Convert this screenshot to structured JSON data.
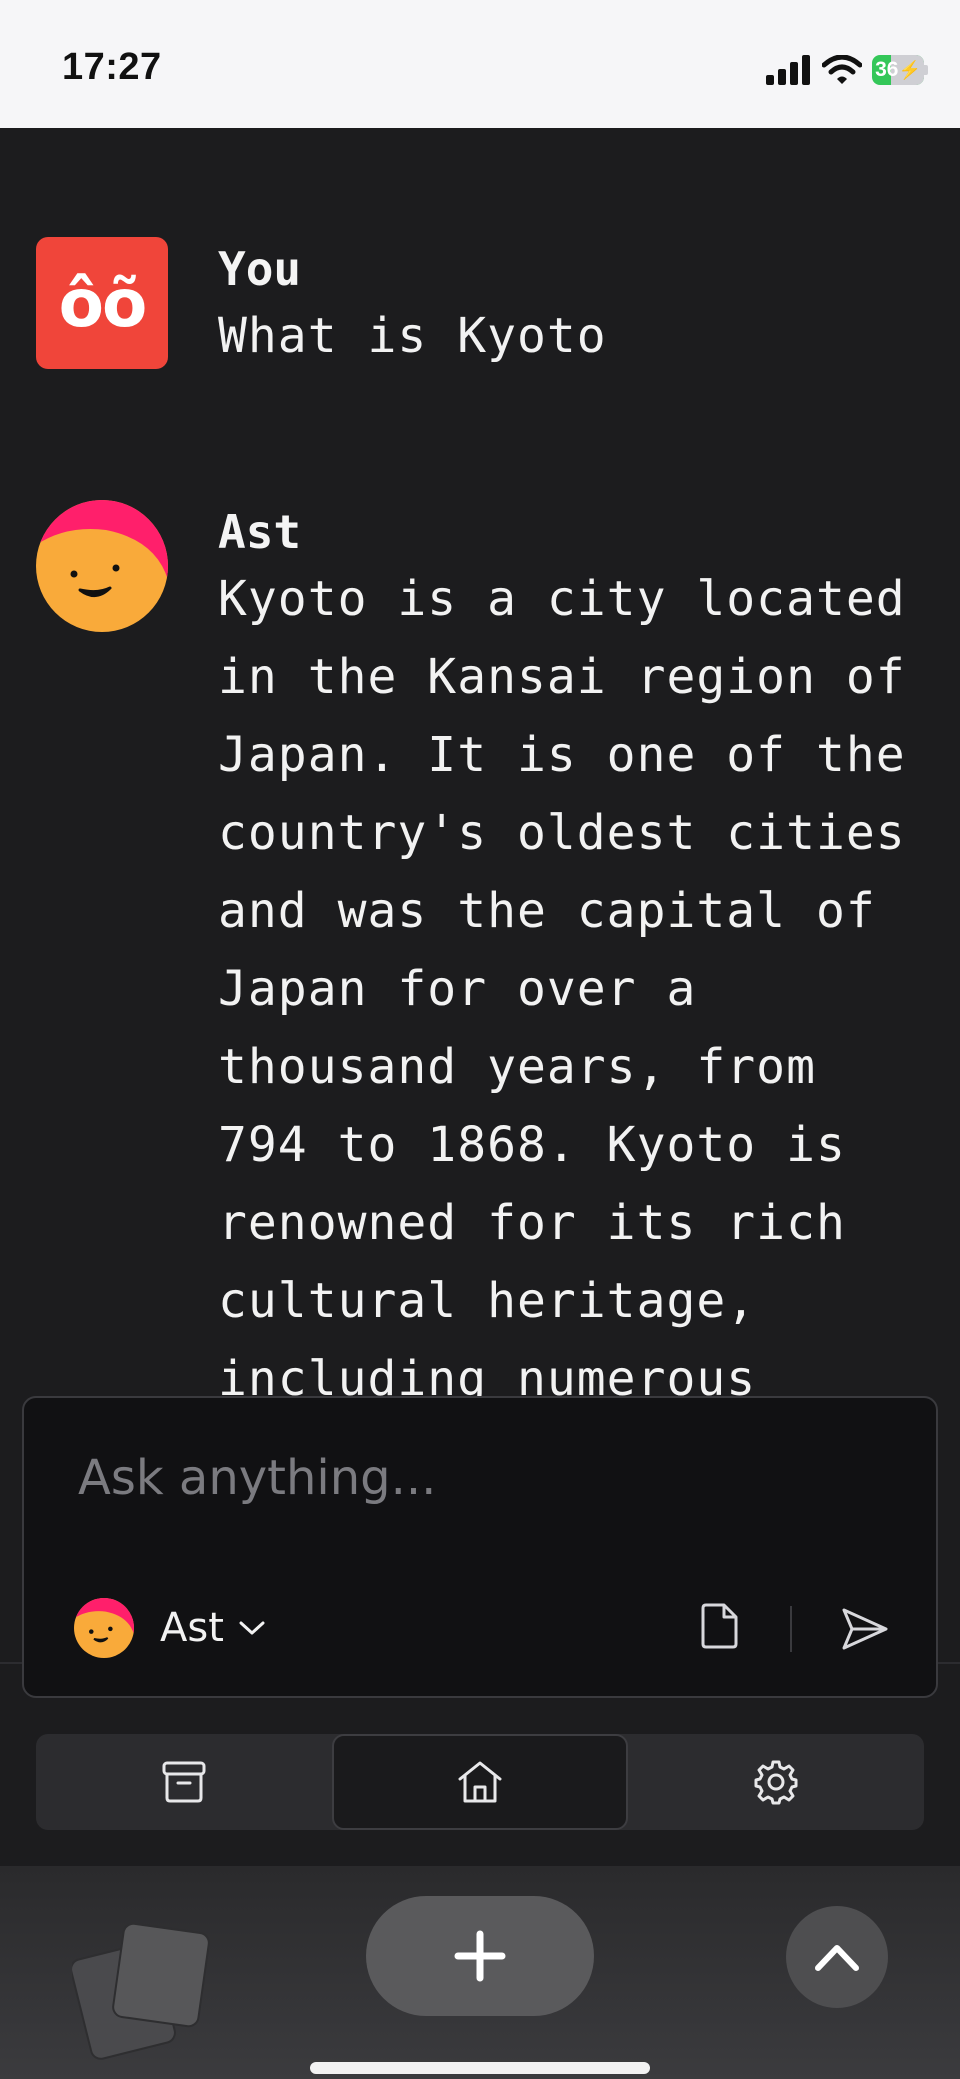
{
  "status_bar": {
    "time": "17:27",
    "battery": "36",
    "battery_level": 0.36,
    "icons": [
      "signal-icon",
      "wifi-icon",
      "battery-icon",
      "charging-bolt-icon"
    ]
  },
  "chat": {
    "messages": [
      {
        "author": "You",
        "avatar_initials": "ôõ",
        "avatar_color": "#f0453a",
        "text": "What is Kyoto"
      },
      {
        "author": "Ast",
        "avatar": "smiley-avatar-icon",
        "lines": [
          "Kyoto is a city located",
          "in the Kansai region of",
          "Japan. It is one of the",
          "country's oldest cities",
          "and was the capital of",
          "Japan for over a",
          "thousand years, from",
          "794 to 1868. Kyoto is",
          "renowned for its rich",
          "cultural heritage,",
          "including numerous"
        ]
      }
    ]
  },
  "composer": {
    "placeholder": "Ask anything...",
    "model_name": "Ast",
    "icons": [
      "smiley-avatar-icon",
      "chevron-down-icon",
      "file-icon",
      "send-icon"
    ]
  },
  "nav": {
    "items": [
      "archive-icon",
      "home-icon",
      "gear-icon"
    ],
    "active": "home-icon"
  },
  "toolbar": {
    "icons": [
      "tabs-icon",
      "plus-icon",
      "chevron-up-icon"
    ]
  },
  "colors": {
    "background": "#1c1c1e",
    "user_avatar": "#f0453a",
    "battery": "#34c759",
    "assistant_avatar_face": "#f9aa3a",
    "assistant_avatar_hat": "#ff1f6b"
  }
}
